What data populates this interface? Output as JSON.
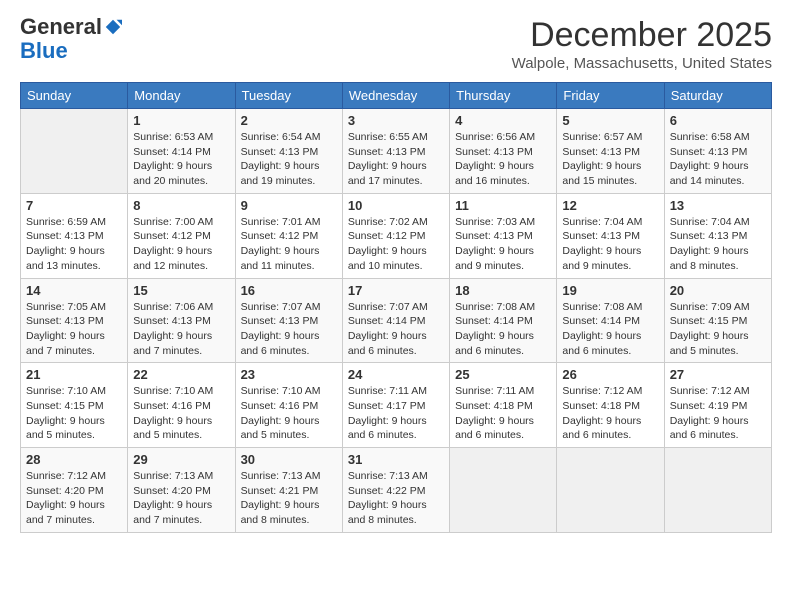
{
  "logo": {
    "general": "General",
    "blue": "Blue"
  },
  "header": {
    "month": "December 2025",
    "location": "Walpole, Massachusetts, United States"
  },
  "days_of_week": [
    "Sunday",
    "Monday",
    "Tuesday",
    "Wednesday",
    "Thursday",
    "Friday",
    "Saturday"
  ],
  "weeks": [
    [
      {
        "day": "",
        "info": ""
      },
      {
        "day": "1",
        "info": "Sunrise: 6:53 AM\nSunset: 4:14 PM\nDaylight: 9 hours and 20 minutes."
      },
      {
        "day": "2",
        "info": "Sunrise: 6:54 AM\nSunset: 4:13 PM\nDaylight: 9 hours and 19 minutes."
      },
      {
        "day": "3",
        "info": "Sunrise: 6:55 AM\nSunset: 4:13 PM\nDaylight: 9 hours and 17 minutes."
      },
      {
        "day": "4",
        "info": "Sunrise: 6:56 AM\nSunset: 4:13 PM\nDaylight: 9 hours and 16 minutes."
      },
      {
        "day": "5",
        "info": "Sunrise: 6:57 AM\nSunset: 4:13 PM\nDaylight: 9 hours and 15 minutes."
      },
      {
        "day": "6",
        "info": "Sunrise: 6:58 AM\nSunset: 4:13 PM\nDaylight: 9 hours and 14 minutes."
      }
    ],
    [
      {
        "day": "7",
        "info": "Sunrise: 6:59 AM\nSunset: 4:13 PM\nDaylight: 9 hours and 13 minutes."
      },
      {
        "day": "8",
        "info": "Sunrise: 7:00 AM\nSunset: 4:12 PM\nDaylight: 9 hours and 12 minutes."
      },
      {
        "day": "9",
        "info": "Sunrise: 7:01 AM\nSunset: 4:12 PM\nDaylight: 9 hours and 11 minutes."
      },
      {
        "day": "10",
        "info": "Sunrise: 7:02 AM\nSunset: 4:12 PM\nDaylight: 9 hours and 10 minutes."
      },
      {
        "day": "11",
        "info": "Sunrise: 7:03 AM\nSunset: 4:13 PM\nDaylight: 9 hours and 9 minutes."
      },
      {
        "day": "12",
        "info": "Sunrise: 7:04 AM\nSunset: 4:13 PM\nDaylight: 9 hours and 9 minutes."
      },
      {
        "day": "13",
        "info": "Sunrise: 7:04 AM\nSunset: 4:13 PM\nDaylight: 9 hours and 8 minutes."
      }
    ],
    [
      {
        "day": "14",
        "info": "Sunrise: 7:05 AM\nSunset: 4:13 PM\nDaylight: 9 hours and 7 minutes."
      },
      {
        "day": "15",
        "info": "Sunrise: 7:06 AM\nSunset: 4:13 PM\nDaylight: 9 hours and 7 minutes."
      },
      {
        "day": "16",
        "info": "Sunrise: 7:07 AM\nSunset: 4:13 PM\nDaylight: 9 hours and 6 minutes."
      },
      {
        "day": "17",
        "info": "Sunrise: 7:07 AM\nSunset: 4:14 PM\nDaylight: 9 hours and 6 minutes."
      },
      {
        "day": "18",
        "info": "Sunrise: 7:08 AM\nSunset: 4:14 PM\nDaylight: 9 hours and 6 minutes."
      },
      {
        "day": "19",
        "info": "Sunrise: 7:08 AM\nSunset: 4:14 PM\nDaylight: 9 hours and 6 minutes."
      },
      {
        "day": "20",
        "info": "Sunrise: 7:09 AM\nSunset: 4:15 PM\nDaylight: 9 hours and 5 minutes."
      }
    ],
    [
      {
        "day": "21",
        "info": "Sunrise: 7:10 AM\nSunset: 4:15 PM\nDaylight: 9 hours and 5 minutes."
      },
      {
        "day": "22",
        "info": "Sunrise: 7:10 AM\nSunset: 4:16 PM\nDaylight: 9 hours and 5 minutes."
      },
      {
        "day": "23",
        "info": "Sunrise: 7:10 AM\nSunset: 4:16 PM\nDaylight: 9 hours and 5 minutes."
      },
      {
        "day": "24",
        "info": "Sunrise: 7:11 AM\nSunset: 4:17 PM\nDaylight: 9 hours and 6 minutes."
      },
      {
        "day": "25",
        "info": "Sunrise: 7:11 AM\nSunset: 4:18 PM\nDaylight: 9 hours and 6 minutes."
      },
      {
        "day": "26",
        "info": "Sunrise: 7:12 AM\nSunset: 4:18 PM\nDaylight: 9 hours and 6 minutes."
      },
      {
        "day": "27",
        "info": "Sunrise: 7:12 AM\nSunset: 4:19 PM\nDaylight: 9 hours and 6 minutes."
      }
    ],
    [
      {
        "day": "28",
        "info": "Sunrise: 7:12 AM\nSunset: 4:20 PM\nDaylight: 9 hours and 7 minutes."
      },
      {
        "day": "29",
        "info": "Sunrise: 7:13 AM\nSunset: 4:20 PM\nDaylight: 9 hours and 7 minutes."
      },
      {
        "day": "30",
        "info": "Sunrise: 7:13 AM\nSunset: 4:21 PM\nDaylight: 9 hours and 8 minutes."
      },
      {
        "day": "31",
        "info": "Sunrise: 7:13 AM\nSunset: 4:22 PM\nDaylight: 9 hours and 8 minutes."
      },
      {
        "day": "",
        "info": ""
      },
      {
        "day": "",
        "info": ""
      },
      {
        "day": "",
        "info": ""
      }
    ]
  ]
}
